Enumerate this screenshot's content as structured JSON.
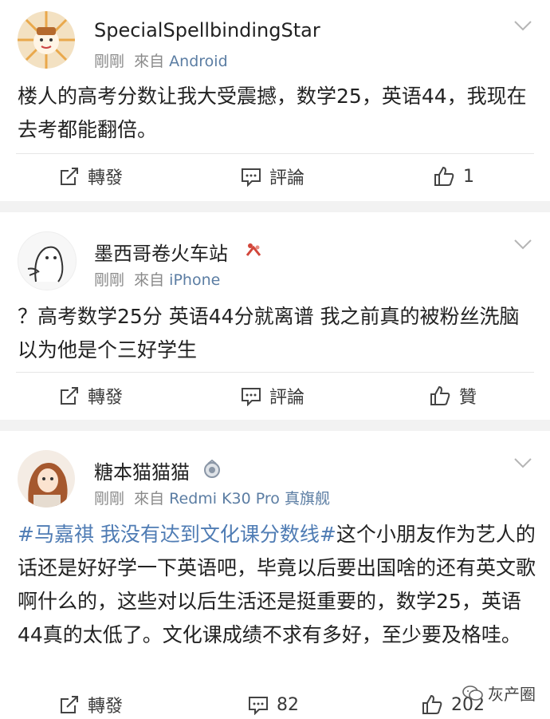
{
  "posts": [
    {
      "username": "SpecialSpellbindingStar",
      "time": "剛剛",
      "from_label": "來自",
      "source": "Android",
      "text": "楼人的高考分数让我大受震撼，数学25，英语44，我现在去考都能翻倍。",
      "repost_label": "轉發",
      "comment_label": "評論",
      "like_label": "1"
    },
    {
      "username": "墨西哥卷火车站",
      "time": "剛剛",
      "from_label": "來自",
      "source": "iPhone",
      "text": "？高考数学25分 英语44分就离谱 我之前真的被粉丝洗脑以为他是个三好学生",
      "repost_label": "轉發",
      "comment_label": "評論",
      "like_label": "贊"
    },
    {
      "username": "糖本猫猫猫",
      "time": "剛剛",
      "from_label": "來自",
      "source": "Redmi K30 Pro 真旗舰",
      "hashtag": "#马嘉祺 我没有达到文化课分数线#",
      "text": "这个小朋友作为艺人的话还是好好学一下英语吧，毕竟以后要出国啥的还有英文歌啊什么的，这些对以后生活还是挺重要的，数学25，英语44真的太低了。文化课成绩不求有多好，至少要及格哇。",
      "repost_label": "轉發",
      "comment_label": "82",
      "like_label": "202"
    }
  ],
  "watermark": "灰产圈",
  "icons": [
    "chevron-down-icon",
    "repost-icon",
    "comment-icon",
    "like-icon",
    "badge-icon",
    "wechat-icon"
  ]
}
